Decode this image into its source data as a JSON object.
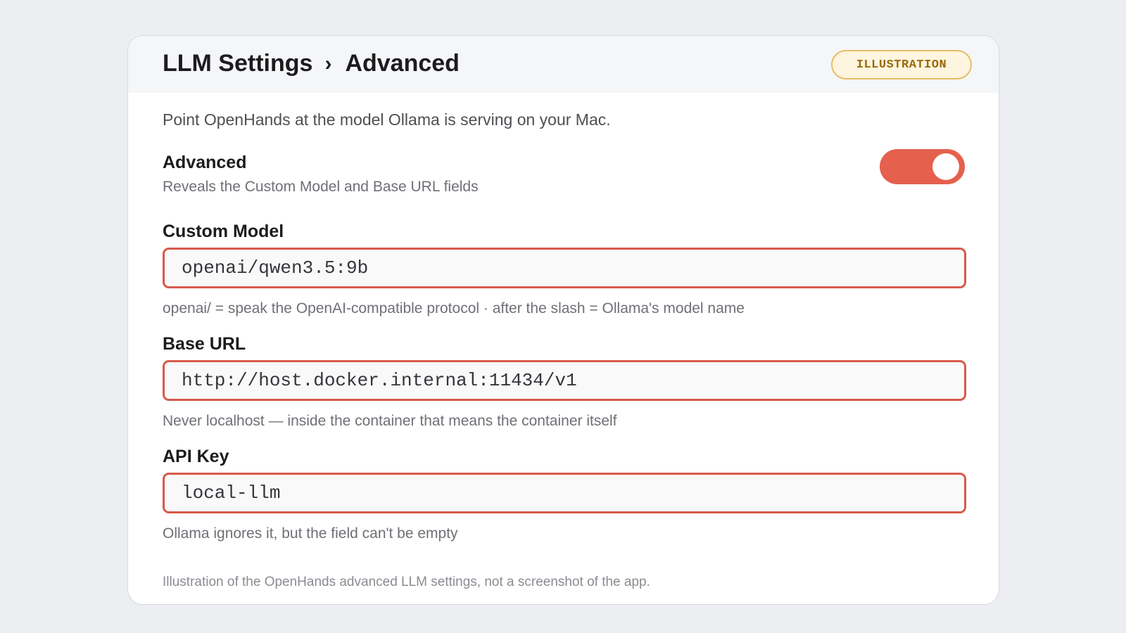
{
  "header": {
    "breadcrumb": [
      "LLM Settings",
      "Advanced"
    ],
    "separator": "›",
    "badge": "ILLUSTRATION"
  },
  "intro": "Point OpenHands at the model Ollama is serving on your Mac.",
  "advanced": {
    "title": "Advanced",
    "description": "Reveals the Custom Model and Base URL fields",
    "enabled": true
  },
  "fields": {
    "custom_model": {
      "label": "Custom Model",
      "value": "openai/qwen3.5:9b",
      "hint": "openai/ = speak the OpenAI-compatible protocol · after the slash = Ollama's model name"
    },
    "base_url": {
      "label": "Base URL",
      "value": "http://host.docker.internal:11434/v1",
      "hint": "Never localhost — inside the container that means the container itself"
    },
    "api_key": {
      "label": "API Key",
      "value": "local-llm",
      "hint": "Ollama ignores it, but the field can't be empty"
    }
  },
  "footnote": "Illustration of the OpenHands advanced LLM settings, not a screenshot of the app.",
  "colors": {
    "accent": "#e5604d",
    "badge_border": "#e6bd63",
    "badge_text": "#9a6a07"
  }
}
